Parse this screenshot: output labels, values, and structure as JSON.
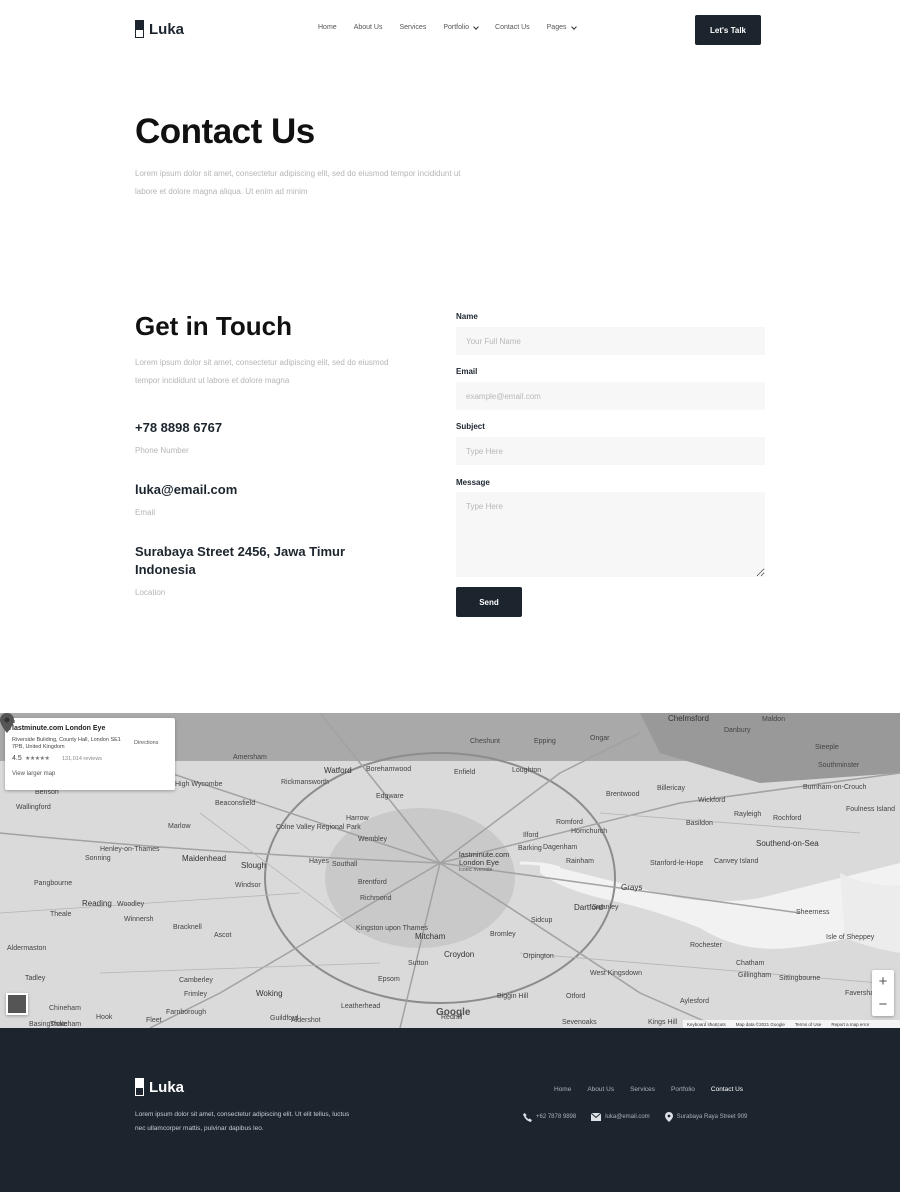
{
  "brand": {
    "name": "Luka"
  },
  "nav": {
    "items": [
      {
        "label": "Home",
        "dropdown": false
      },
      {
        "label": "About Us",
        "dropdown": false
      },
      {
        "label": "Services",
        "dropdown": false
      },
      {
        "label": "Portfolio",
        "dropdown": true
      },
      {
        "label": "Contact Us",
        "dropdown": false
      },
      {
        "label": "Pages",
        "dropdown": true
      }
    ],
    "cta_label": "Let's Talk"
  },
  "hero": {
    "title": "Contact Us",
    "description": "Lorem ipsum dolor sit amet, consectetur adipiscing elit, sed do eiusmod tempor incididunt ut labore et dolore magna aliqua. Ut enim ad minim"
  },
  "get_in_touch": {
    "title": "Get in Touch",
    "description": "Lorem ipsum dolor sit amet, consectetur adipiscing elit, sed do eiusmod tempor incididunt ut labore et dolore magna",
    "phone": {
      "value": "+78 8898 6767",
      "label": "Phone Number"
    },
    "email": {
      "value": "luka@email.com",
      "label": "Email"
    },
    "location": {
      "line1": "Surabaya Street 2456, Jawa Timur",
      "line2": "Indonesia",
      "label": "Location"
    }
  },
  "form": {
    "name": {
      "label": "Name",
      "placeholder": "Your Full Name"
    },
    "email": {
      "label": "Email",
      "placeholder": "example@email.com"
    },
    "subject": {
      "label": "Subject",
      "placeholder": "Type Here"
    },
    "message": {
      "label": "Message",
      "placeholder": "Type Here"
    },
    "send_label": "Send"
  },
  "map": {
    "card": {
      "title": "lastminute.com London Eye",
      "address": "Riverside Building, County Hall, London SE1 7PB, United Kingdom",
      "rating": "4.5",
      "stars": "★★★★★",
      "reviews": "131,014 reviews",
      "larger_map": "View larger map",
      "directions": "Directions"
    },
    "pin_label_1": "lastminute.com",
    "pin_label_2": "London Eye",
    "pin_sub": "Iconic riverside",
    "google": "Google",
    "footer": {
      "shortcuts": "Keyboard shortcuts",
      "map_data": "Map data ©2021 Google",
      "terms": "Terms of Use",
      "report": "Report a map error"
    },
    "places": [
      "Chelmsford",
      "Maldon",
      "Danbury",
      "Watford",
      "Enfield",
      "Cheshunt",
      "Epping",
      "Ongar",
      "High Wycombe",
      "Brentwood",
      "Billericay",
      "Wickford",
      "Rayleigh",
      "Rochford",
      "Foulness Island",
      "Southend-on-Sea",
      "Basildon",
      "Edgware",
      "Harrow",
      "Wembley",
      "Romford",
      "Hornchurch",
      "Ilford",
      "Barking",
      "Dagenham",
      "Rainham",
      "Stanford-le-Hope",
      "Canvey Island",
      "Grays",
      "Maidenhead",
      "Slough",
      "Hayes",
      "Southall",
      "Windsor",
      "Brentford",
      "Richmond",
      "Reading",
      "Woodley",
      "Bracknell",
      "Ascot",
      "Kingston upon Thames",
      "Mitcham",
      "Croydon",
      "Bromley",
      "Dartford",
      "Sutton",
      "Epsom",
      "Woking",
      "Leatherhead",
      "Guildford",
      "Rochester",
      "Chatham",
      "Gillingham",
      "Sittingbourne",
      "Sheerness",
      "Isle of Sheppey",
      "Beaconsfield",
      "Marlow",
      "Colne Valley Regional Park",
      "Amersham",
      "Borehamwood",
      "Rickmansworth",
      "Camberley",
      "Farnborough",
      "Fleet",
      "Hook",
      "Basingstoke",
      "Aldershot",
      "Frimley",
      "Biggin Hill",
      "Otford",
      "Sevenoaks",
      "West Kingsdown",
      "Aylesford",
      "Kings Hill",
      "Redhill",
      "Swanley",
      "Orpington",
      "Sidcup",
      "Tadley",
      "Chineham",
      "Thatcham",
      "Wallingford",
      "Benson",
      "Henley-on-Thames",
      "Sonning",
      "Pangbourne",
      "Theale",
      "Winnersh",
      "Aldermaston",
      "Loughton",
      "Faversham",
      "Southminster",
      "Burnham-on-Crouch",
      "Steeple"
    ]
  },
  "footer": {
    "brand": "Luka",
    "description": "Lorem ipsum dolor sit amet, consectetur adipiscing elit. Ut elit tellus, luctus nec ullamcorper mattis, pulvinar dapibus leo.",
    "nav": [
      "Home",
      "About Us",
      "Services",
      "Portfolio",
      "Contact Us"
    ],
    "phone": "+62 7878 9898",
    "email": "luka@email.com",
    "address": "Surabaya Raya Street 909"
  },
  "colors": {
    "primary": "#1c252e",
    "muted": "#b5b5b5",
    "input_bg": "#f7f7f7"
  }
}
